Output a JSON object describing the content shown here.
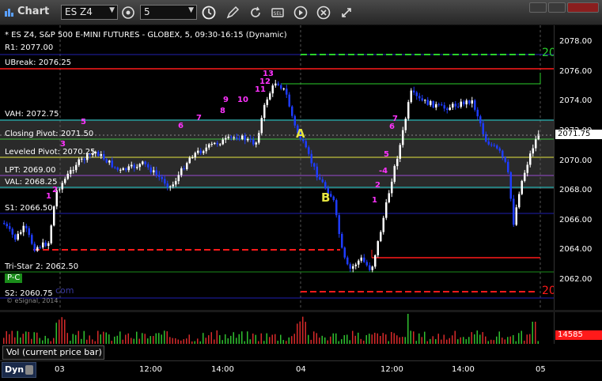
{
  "toolbar": {
    "app_name": "Chart",
    "symbol": "ES Z4",
    "interval": "5",
    "icons": [
      "crosshair-icon",
      "clock-icon",
      "pencil-icon",
      "refresh-icon",
      "screenshot-icon",
      "play-icon",
      "close-icon",
      "link-icon"
    ]
  },
  "chart": {
    "title": "* ES Z4, S&P 500 E-MINI FUTURES - GLOBEX, 5, 09:30-16:15 (Dynamic)",
    "last_price": "2071.75",
    "price_axis": [
      "2078.00",
      "2076.00",
      "2074.00",
      "2072.00",
      "2070.00",
      "2068.00",
      "2066.00",
      "2064.00",
      "2062.00"
    ],
    "time_axis": [
      "03",
      "12:00",
      "14:00",
      "04",
      "12:00",
      "14:00",
      "05"
    ],
    "levels": [
      {
        "label": "R1: 2077.00"
      },
      {
        "label": "UBreak: 2076.25"
      },
      {
        "label": "VAH: 2072.75"
      },
      {
        "label": "Closing Pivot: 2071.50"
      },
      {
        "label": "Leveled Pivot: 2070.25"
      },
      {
        "label": "LPT: 2069.00"
      },
      {
        "label": "VAL: 2068.25"
      },
      {
        "label": "S1: 2066.50"
      },
      {
        "label": "Tri-Star 2: 2062.50"
      },
      {
        "label": "S2: 2060.75"
      }
    ],
    "annotations": {
      "a": "A",
      "b": "B",
      "upper_count": "20",
      "lower_count": "20",
      "pc": "P-C",
      "copyright": "© eSignal, 2014",
      "watermark": "com"
    },
    "countdown_labels": [
      "1",
      "2",
      "3",
      "5",
      "6",
      "7",
      "8",
      "9",
      "10",
      "11",
      "12",
      "13",
      "1",
      "2",
      "-4",
      "5",
      "6",
      "7"
    ]
  },
  "volume": {
    "label": "Vol (current price bar)",
    "last_value": "14585"
  },
  "bottom": {
    "label": "Dyn"
  },
  "colors": {
    "up": "#ffffff",
    "down": "#1e3cff",
    "green_line": "#1a8c1a",
    "red_line": "#ff1a1a",
    "blue_line": "#2020b0",
    "cyan_line": "#20d0d0",
    "yellow_line": "#e6e640"
  }
}
